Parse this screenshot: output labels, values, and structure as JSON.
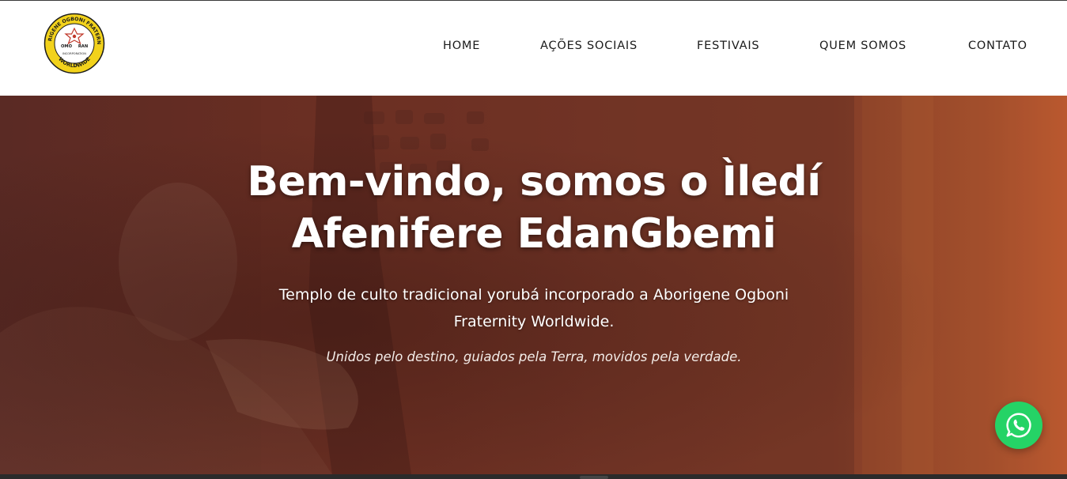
{
  "logo": {
    "ring_text_top": "ABORIGENE OGBONI FRATERNITY",
    "ring_text_bottom": "WORLDWIDE",
    "center_left": "OMO",
    "center_right": "RAN",
    "center_bottom": "INCORPORATION",
    "colors": {
      "ring": "#f2d21b",
      "border": "#1a1a1a"
    }
  },
  "nav": {
    "items": [
      {
        "label": "HOME"
      },
      {
        "label": "AÇÕES SOCIAIS"
      },
      {
        "label": "FESTIVAIS"
      },
      {
        "label": "QUEM SOMOS"
      },
      {
        "label": "CONTATO"
      }
    ]
  },
  "hero": {
    "title_line1": "Bem-vindo, somos o Ìledí",
    "title_line2": "Afenifere EdanGbemi",
    "subtitle_line1": "Templo de culto tradicional yorubá incorporado a Aborigene Ogboni",
    "subtitle_line2": "Fraternity Worldwide.",
    "motto": "Unidos pelo destino, guiados pela Terra, movidos pela verdade."
  },
  "whatsapp": {
    "icon": "whatsapp-icon",
    "color": "#25d366"
  }
}
